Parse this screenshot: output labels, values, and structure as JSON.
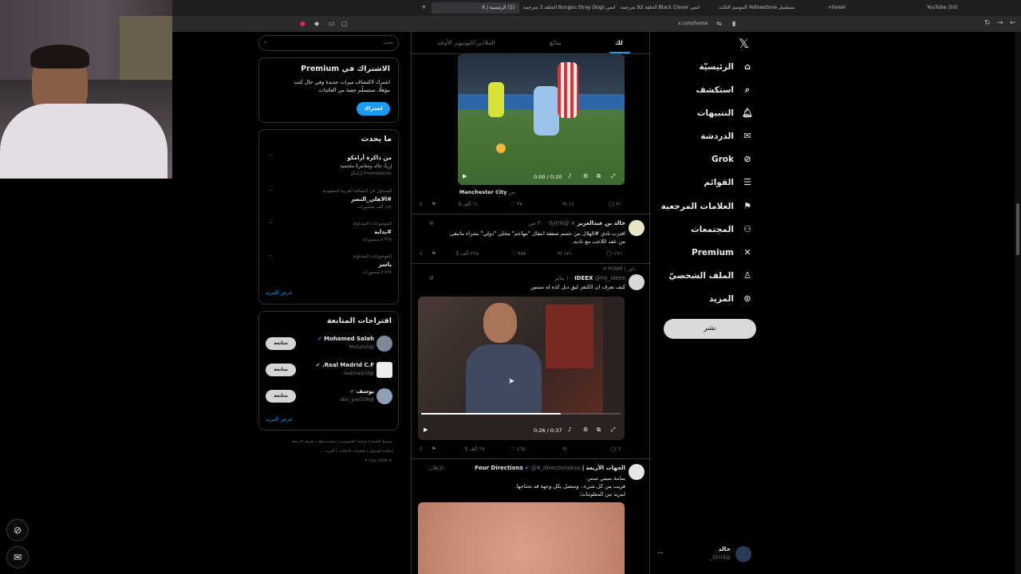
{
  "browser": {
    "tabs": [
      {
        "label": "(50) YouTube"
      },
      {
        "label": "Faisel+"
      },
      {
        "label": "مسلسل Yellowstone الموسم الثالث"
      },
      {
        "label": "انمي Black Clover الحلقة 92 مترجمة"
      },
      {
        "label": "انمي Bungou Stray Dogs الحلقة 3 مترجمة"
      },
      {
        "label": "(1) الرئيسية / X"
      }
    ],
    "new_tab": "+",
    "url": "x.com/home"
  },
  "nav": {
    "items": [
      {
        "label": "الرئيسيّة",
        "icon": "home-icon"
      },
      {
        "label": "استكشف",
        "icon": "search-icon"
      },
      {
        "label": "التنبيهات",
        "icon": "bell-icon"
      },
      {
        "label": "الدردشة",
        "icon": "mail-icon"
      },
      {
        "label": "Grok",
        "icon": "grok-icon"
      },
      {
        "label": "القوائم",
        "icon": "list-icon"
      },
      {
        "label": "العلامات المرجعية",
        "icon": "bookmark-icon"
      },
      {
        "label": "المجتمعات",
        "icon": "communities-icon"
      },
      {
        "label": "Premium",
        "icon": "x-logo-icon"
      },
      {
        "label": "الملف الشخصيّ",
        "icon": "profile-icon"
      },
      {
        "label": "المزيد",
        "icon": "more-icon"
      }
    ],
    "post_button": "نشر",
    "account": {
      "name": "خالد",
      "handle": "@5hlid_",
      "more": "..."
    }
  },
  "timeline": {
    "tabs": [
      "لك",
      "متابَع",
      "الملاذين/اليوتيوبر الأوحد"
    ],
    "post1": {
      "video_time": "0:00 / 0:20",
      "source_prefix": "من",
      "source": "Manchester City",
      "replies": "٣١",
      "reposts": "١٦",
      "likes": "٣٧٠",
      "views": "٦١ ألف"
    },
    "post2": {
      "name": "خالد بن عبدالعزيز",
      "handle": "@0ytrb",
      "time": "٣٠ س",
      "text_line1": "اقترب نادي #الهلال من حسم صفقة انتقال \"مهاجم\" محلي \"دولي\" بشراء ماتبقى",
      "text_line2": "من عقد اللاعب مع ناديه.",
      "replies": "١٩٦",
      "reposts": "١٧١",
      "likes": "٩٥٨",
      "views": "٢٢٥ ألف"
    },
    "post3": {
      "repost_note": "باور | POWR",
      "name": "IDEEX",
      "handle": "@mj_ideex",
      "time": "١ يناير",
      "text": "كيف تعرف ان الكنقز ليق دبل كذه له سنتين",
      "video_time": "0:26 / 0:37",
      "replies": "٦",
      "reposts": "",
      "likes": "٤٦٥",
      "views": "٢٨ ألف"
    },
    "post4": {
      "name": "الجهات الأربعة | Four Directions",
      "handle": "@4_directionsksa",
      "ad_label": "الإعلان",
      "line1": "يمامة سيتي سنتر،",
      "line2": "قريب من كل شيء.. ومتصل بكل وجهة قد تحتاجها.",
      "line3": "لمزيد من المعلومات:"
    }
  },
  "sidebar": {
    "search_placeholder": "بحث",
    "premium": {
      "title": "الاشتراك في Premium",
      "text_line1": "اشترك لاكتشاف ميزات جديدة وفي حال كنت",
      "text_line2": "مؤهلًا، ستتسلّم حصة من العائدات",
      "button": "اشتراك"
    },
    "trends": {
      "title": "ما يحدث",
      "items": [
        {
          "context": "",
          "name": "من ذاكرة أرامكو",
          "sub": "إرثٌ خالد ومغامرةٌ ملحمية",
          "promo": "Promoted by أرامكو"
        },
        {
          "context": "المتداول في المملكة العربية السعودية",
          "name": "#الاهلي_النصر",
          "sub": "١٥٧ ألف منشورات",
          "promo": ""
        },
        {
          "context": "الموضوعات المتداولة",
          "name": "#بداية",
          "sub": "٨٬٣٦٨ منشورات",
          "promo": ""
        },
        {
          "context": "الموضوعات المتداولة",
          "name": "ياسر",
          "sub": "٥٬٨٢٨ منشورات",
          "promo": ""
        }
      ],
      "more": "عرض المزيد"
    },
    "follow": {
      "title": "اقتراحات المتابعة",
      "items": [
        {
          "name": "Mohamed Salah",
          "handle": "@MoSalah",
          "button": "متابعة"
        },
        {
          "name": "Real Madrid C.F.",
          "handle": "@realmadrid",
          "button": "متابعة"
        },
        {
          "name": "يوسف",
          "handle": "@abo_yan506",
          "button": "متابعة"
        }
      ],
      "more": "عرض المزيد"
    },
    "footer": {
      "line1": [
        "شروط الخدمة",
        "سياسة الخصوصية",
        "سياسة ملفات تعريف الارتباط"
      ],
      "line2": [
        "إمكانية الوصول",
        "معلومات الإعلانات",
        "المزيد ..."
      ],
      "copyright": "© 2026 X Corp."
    }
  },
  "colors": {
    "accent": "#1d9bf0",
    "background": "#000000",
    "border": "#2f3336",
    "muted": "#71767b",
    "premium_button": "#1d9bf0"
  }
}
